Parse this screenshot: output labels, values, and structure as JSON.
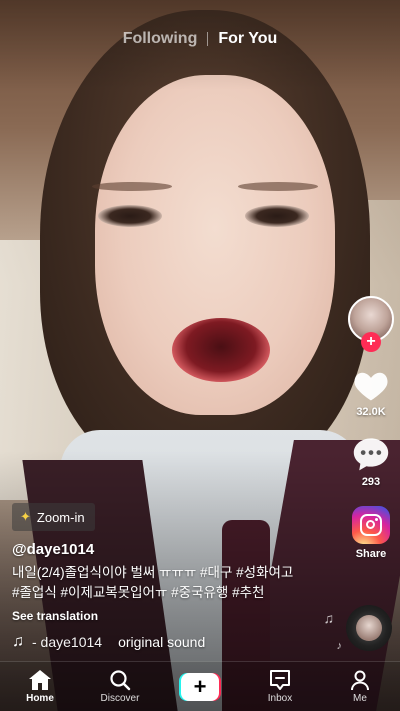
{
  "top_tabs": {
    "following": "Following",
    "for_you": "For You"
  },
  "rail": {
    "likes": "32.0K",
    "comments": "293",
    "share": "Share"
  },
  "video_info": {
    "effect": "Zoom-in",
    "username": "@daye1014",
    "caption_line1": "내일(2/4)졸업식이야 벌써 ㅠㅠㅠ #대구 #성화여고",
    "caption_line2": "#졸업식 #이제교복못입어ㅠ #중국유행 #추천",
    "see_translation": "See translation",
    "sound_author": " - daye1014",
    "sound_title": "original sound"
  },
  "bottom_nav": {
    "home": "Home",
    "discover": "Discover",
    "inbox": "Inbox",
    "me": "Me"
  },
  "icons": {
    "like": "heart-icon",
    "comment": "comment-icon",
    "share": "instagram-icon",
    "home": "home-icon",
    "discover": "search-icon",
    "create": "plus-icon",
    "inbox": "inbox-icon",
    "me": "profile-icon",
    "sound": "music-note-icon"
  },
  "colors": {
    "accent_red": "#fe2c55",
    "accent_cyan": "#25f4ee"
  }
}
